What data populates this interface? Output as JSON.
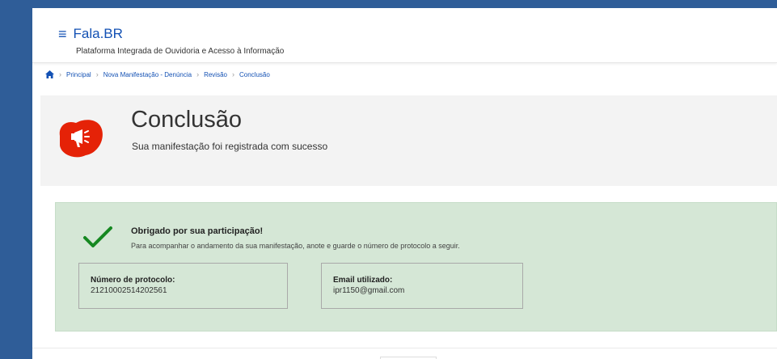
{
  "header": {
    "brand": "Fala.BR",
    "subtitle": "Plataforma Integrada de Ouvidoria e Acesso à Informação",
    "menu_icon": "hamburger-menu-icon"
  },
  "breadcrumb": {
    "home_icon": "home-icon",
    "items": [
      "Principal",
      "Nova Manifestação - Denúncia",
      "Revisão",
      "Conclusão"
    ]
  },
  "hero": {
    "title": "Conclusão",
    "subtitle": "Sua manifestação foi registrada com sucesso",
    "icon": "megaphone-icon"
  },
  "success": {
    "icon": "check-icon",
    "title": "Obrigado por sua participação!",
    "instructions": "Para acompanhar o andamento da sua manifestação, anote e guarde o número de protocolo a seguir.",
    "protocol_label": "Número de protocolo:",
    "protocol_value": "21210002514202561",
    "email_label": "Email utilizado:",
    "email_value": "ipr1150@gmail.com"
  },
  "colors": {
    "brand_blue": "#1351b4",
    "success_bg": "#d5e7d6",
    "check_green": "#168821",
    "hero_red": "#e52207",
    "page_bg": "#2f5d98"
  }
}
